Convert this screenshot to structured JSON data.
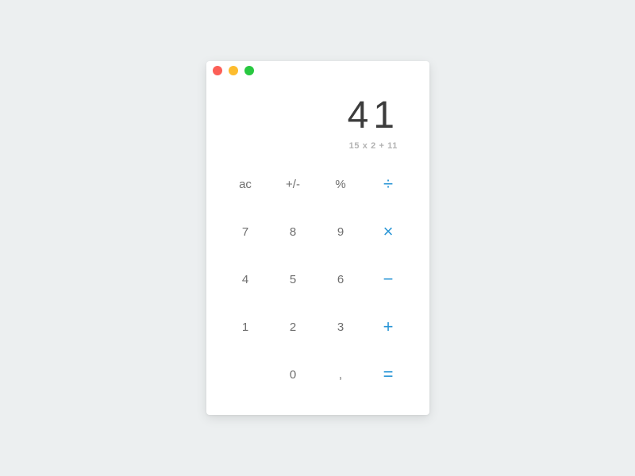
{
  "colors": {
    "background": "#eceff0",
    "window": "#ffffff",
    "close": "#fc5f57",
    "minimize": "#fdbc2e",
    "maximize": "#28c840",
    "operator": "#2a96d6",
    "digit": "#6e6e6e",
    "result": "#3c3c3c",
    "expression": "#b3b3b3"
  },
  "window_controls": {
    "close_icon": "close-icon",
    "minimize_icon": "minimize-icon",
    "maximize_icon": "maximize-icon"
  },
  "display": {
    "result": "41",
    "expression": "15 x 2 + 11"
  },
  "keys": {
    "ac": "ac",
    "sign": "+/-",
    "percent": "%",
    "divide": "÷",
    "seven": "7",
    "eight": "8",
    "nine": "9",
    "multiply": "×",
    "four": "4",
    "five": "5",
    "six": "6",
    "minus": "−",
    "one": "1",
    "two": "2",
    "three": "3",
    "plus": "+",
    "zero": "0",
    "comma": ",",
    "equals": "="
  }
}
